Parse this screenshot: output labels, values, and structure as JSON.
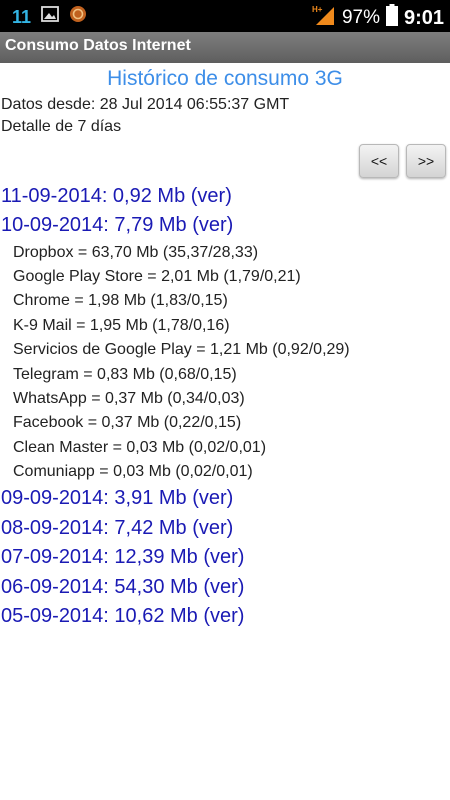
{
  "status_bar": {
    "notification_count": "11",
    "battery": "97%",
    "time": "9:01",
    "icons": [
      "image-icon",
      "circle-app-icon",
      "network-hplus-icon",
      "battery-icon"
    ]
  },
  "app_title": "Consumo Datos Internet",
  "heading": "Histórico de consumo 3G",
  "info": {
    "since": "Datos desde: 28 Jul 2014 06:55:37 GMT",
    "detail": "Detalle de 7 días"
  },
  "nav": {
    "prev_label": "<<",
    "next_label": ">>"
  },
  "days": [
    {
      "label": "11-09-2014: 0,92 Mb (ver)"
    },
    {
      "label": "10-09-2014: 7,79 Mb (ver)"
    },
    {
      "label": "09-09-2014: 3,91 Mb (ver)"
    },
    {
      "label": "08-09-2014: 7,42 Mb (ver)"
    },
    {
      "label": "07-09-2014: 12,39 Mb (ver)"
    },
    {
      "label": "06-09-2014: 54,30 Mb (ver)"
    },
    {
      "label": "05-09-2014: 10,62 Mb (ver)"
    }
  ],
  "apps": [
    "Dropbox = 63,70 Mb (35,37/28,33)",
    "Google Play Store = 2,01 Mb (1,79/0,21)",
    "Chrome = 1,98 Mb (1,83/0,15)",
    "K-9 Mail = 1,95 Mb (1,78/0,16)",
    "Servicios de Google Play = 1,21 Mb (0,92/0,29)",
    "Telegram = 0,83 Mb (0,68/0,15)",
    "WhatsApp = 0,37 Mb (0,34/0,03)",
    "Facebook = 0,37 Mb (0,22/0,15)",
    "Clean Master = 0,03 Mb (0,02/0,01)",
    "Comuniapp = 0,03 Mb (0,02/0,01)"
  ]
}
